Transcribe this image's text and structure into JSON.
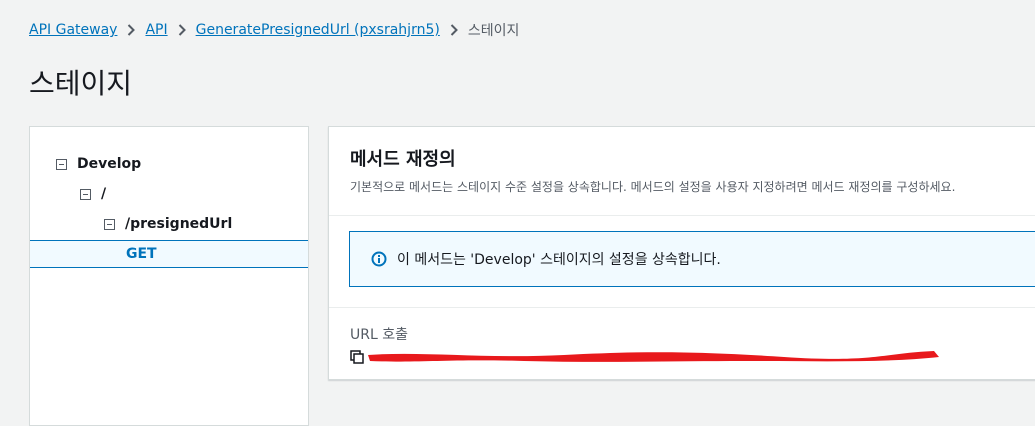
{
  "breadcrumb": {
    "items": [
      "API Gateway",
      "API",
      "GeneratePresignedUrl (pxsrahjrn5)"
    ],
    "current": "스테이지"
  },
  "page": {
    "title": "스테이지"
  },
  "tree": {
    "stage": "Develop",
    "root": "/",
    "resource": "/presignedUrl",
    "method": "GET"
  },
  "panel": {
    "title": "메서드 재정의",
    "description": "기본적으로 메서드는 스테이지 수준 설정을 상속합니다. 메서드의 설정을 사용자 지정하려면 메서드 재정의를 구성하세요.",
    "alert": "이 메서드는 'Develop' 스테이지의 설정을 상속합니다.",
    "invoke_label": "URL 호출",
    "invoke_url": ""
  },
  "colors": {
    "link": "#0073bb",
    "info_border": "#0073bb",
    "info_bg": "#f1faff",
    "redaction": "#e8191c"
  },
  "icons": [
    "chevron-right-icon",
    "collapse-icon",
    "info-icon",
    "copy-icon"
  ]
}
